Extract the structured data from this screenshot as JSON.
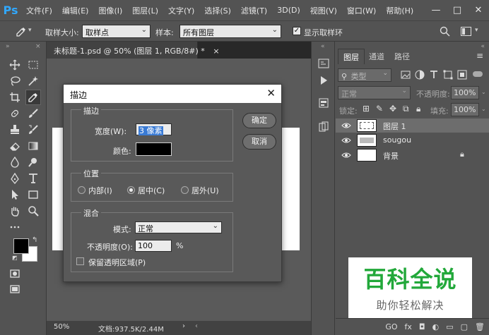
{
  "app": {
    "logo": "Ps",
    "menu": [
      "文件(F)",
      "编辑(E)",
      "图像(I)",
      "图层(L)",
      "文字(Y)",
      "选择(S)",
      "滤镜(T)",
      "3D(D)",
      "视图(V)",
      "窗口(W)",
      "帮助(H)"
    ],
    "window_controls": [
      "—",
      "□",
      "✕"
    ]
  },
  "options_bar": {
    "sample_size_label": "取样大小:",
    "sample_size_value": "取样点",
    "sample_label": "样本:",
    "sample_value": "所有图层",
    "show_ring_label": "显示取样环",
    "show_ring_checked": true
  },
  "document": {
    "tab_title": "未标题-1.psd @ 50% (图层 1, RGB/8#) *",
    "tab_close": "×",
    "zoom": "50%",
    "doc_info": "文档:937.5K/2.44M"
  },
  "layers_panel": {
    "tabs": [
      "图层",
      "通道",
      "路径"
    ],
    "filter_kind": "类型",
    "blend_mode": "正常",
    "opacity_label": "不透明度:",
    "opacity_value": "100%",
    "lock_label": "锁定:",
    "fill_label": "填充:",
    "fill_value": "100%",
    "layers": [
      {
        "name": "图层 1",
        "selected": true
      },
      {
        "name": "sougou",
        "selected": false
      },
      {
        "name": "背景",
        "selected": false
      }
    ],
    "bottom_tools": [
      "GO",
      "fx",
      "◘",
      "◐",
      "▭",
      "▢",
      "🗑"
    ]
  },
  "dialog": {
    "title": "描边",
    "close": "✕",
    "stroke_group": "描边",
    "width_label": "宽度(W):",
    "width_value": "3 像素",
    "color_label": "颜色:",
    "color_value": "#000000",
    "position_group": "位置",
    "positions": [
      {
        "label": "内部(I)",
        "selected": false
      },
      {
        "label": "居中(C)",
        "selected": true
      },
      {
        "label": "居外(U)",
        "selected": false
      }
    ],
    "blend_group": "混合",
    "mode_label": "模式:",
    "mode_value": "正常",
    "opacity_label": "不透明度(O):",
    "opacity_value": "100",
    "opacity_unit": "%",
    "preserve_label": "保留透明区域(P)",
    "ok_label": "确定",
    "cancel_label": "取消"
  },
  "watermark": {
    "main": "百科全说",
    "sub": "助你轻松解决"
  },
  "colors": {
    "foreground": "#000000",
    "background": "#ffffff",
    "ps_blue": "#31a8ff",
    "watermark_green": "#22a83a"
  }
}
